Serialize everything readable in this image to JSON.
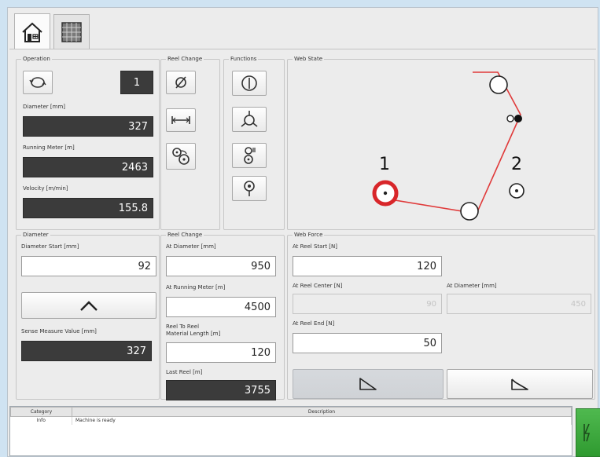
{
  "tabs": [
    {
      "icon": "home-icon"
    },
    {
      "icon": "grid-icon"
    }
  ],
  "operation": {
    "title": "Operation",
    "counter": "1",
    "diameter_label": "Diameter [mm]",
    "diameter_value": "327",
    "running_meter_label": "Running Meter [m]",
    "running_meter_value": "2463",
    "velocity_label": "Velocity [m/min]",
    "velocity_value": "155.8"
  },
  "reel_change_top": {
    "title": "Reel Change"
  },
  "functions": {
    "title": "Functions"
  },
  "web_state": {
    "title": "Web State",
    "reel1_label": "1",
    "reel2_label": "2"
  },
  "diameter": {
    "title": "Diameter",
    "start_label": "Diameter Start [mm]",
    "start_value": "92",
    "sense_label": "Sense Measure Value [mm]",
    "sense_value": "327"
  },
  "reel_change": {
    "title": "Reel Change",
    "at_diameter_label": "At Diameter [mm]",
    "at_diameter_value": "950",
    "at_running_meter_label": "At Running Meter [m]",
    "at_running_meter_value": "4500",
    "reel_to_reel_label_1": "Reel To Reel",
    "reel_to_reel_label_2": "Material Length [m]",
    "reel_to_reel_value": "120",
    "last_reel_label": "Last Reel [m]",
    "last_reel_value": "3755"
  },
  "web_force": {
    "title": "Web Force",
    "at_reel_start_label": "At Reel Start [N]",
    "at_reel_start_value": "120",
    "at_reel_center_label": "At Reel Center [N]",
    "at_reel_center_value": "90",
    "at_diameter_label": "At Diameter [mm]",
    "at_diameter_value": "450",
    "at_reel_end_label": "At Reel End [N]",
    "at_reel_end_value": "50"
  },
  "log": {
    "headers": {
      "category": "Category",
      "description": "Description"
    },
    "rows": [
      {
        "category": "Info",
        "description": "Machine is ready"
      }
    ]
  },
  "colors": {
    "web_line": "#e03a3a",
    "active_reel": "#d8262a",
    "status_green": "#3aa83b"
  }
}
